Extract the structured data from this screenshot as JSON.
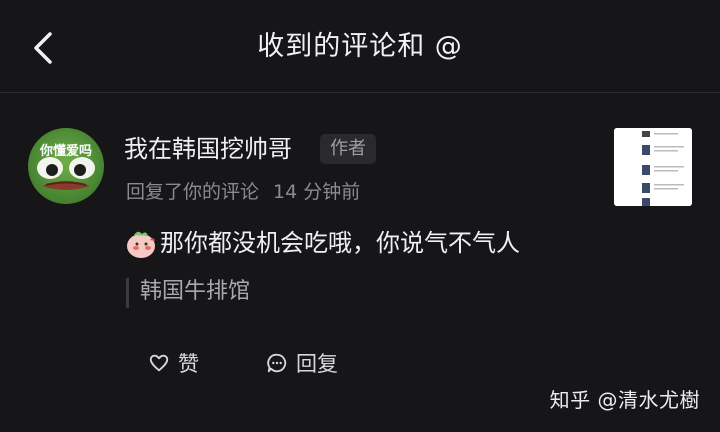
{
  "header": {
    "title": "收到的评论和 @"
  },
  "notification": {
    "avatar_text": "你懂爱吗",
    "username": "我在韩国挖帅哥",
    "badge": "作者",
    "action_text": "回复了你的评论",
    "time": "14 分钟前",
    "comment": "那你都没机会吃哦，你说气不气人",
    "quoted": "韩国牛排馆"
  },
  "actions": {
    "like_label": "赞",
    "reply_label": "回复"
  },
  "watermark": "知乎 @清水尤樹",
  "colors": {
    "background": "#161619",
    "text_primary": "#f0f0f2",
    "text_secondary": "#8a8a90",
    "badge_bg": "#2a2a2e"
  }
}
